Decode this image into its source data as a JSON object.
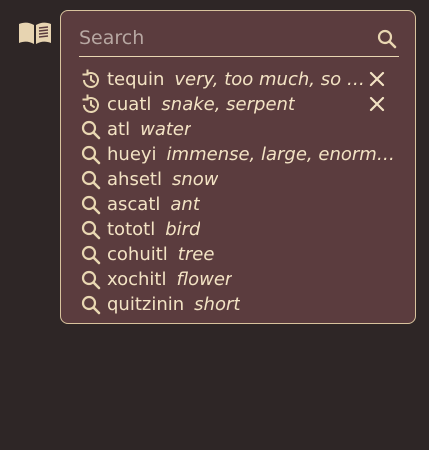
{
  "search": {
    "placeholder": "Search",
    "value": ""
  },
  "icons": {
    "book": "book-icon",
    "search": "search-icon",
    "history": "history-icon",
    "close": "close-icon"
  },
  "colors": {
    "background": "#2e2626",
    "panel": "#5b3c3e",
    "border": "#d9c39d",
    "text": "#f3e3c4",
    "placeholder": "#b7a7a2"
  },
  "results": [
    {
      "type": "history",
      "word": "tequin",
      "gloss": "very, too much, so much"
    },
    {
      "type": "history",
      "word": "cuatl",
      "gloss": "snake, serpent"
    },
    {
      "type": "search",
      "word": "atl",
      "gloss": "water"
    },
    {
      "type": "search",
      "word": "hueyi",
      "gloss": "immense, large, enormous"
    },
    {
      "type": "search",
      "word": "ahsetl",
      "gloss": "snow"
    },
    {
      "type": "search",
      "word": "ascatl",
      "gloss": "ant"
    },
    {
      "type": "search",
      "word": "tototl",
      "gloss": "bird"
    },
    {
      "type": "search",
      "word": "cohuitl",
      "gloss": "tree"
    },
    {
      "type": "search",
      "word": "xochitl",
      "gloss": "flower"
    },
    {
      "type": "search",
      "word": "quitzinin",
      "gloss": "short"
    }
  ]
}
